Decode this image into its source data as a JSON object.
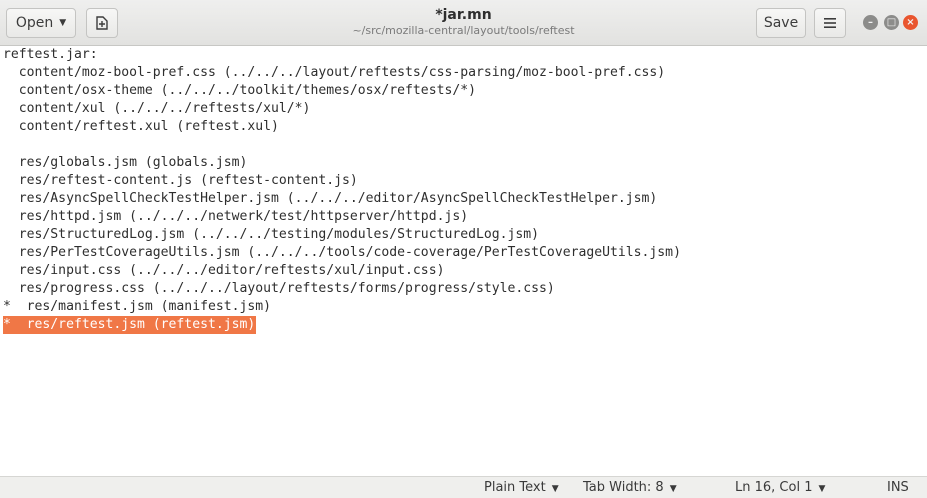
{
  "header": {
    "open_label": "Open",
    "title": "*jar.mn",
    "subtitle": "~/src/mozilla-central/layout/tools/reftest",
    "save_label": "Save"
  },
  "editor": {
    "lines": [
      "reftest.jar:",
      "  content/moz-bool-pref.css (../../../layout/reftests/css-parsing/moz-bool-pref.css)",
      "  content/osx-theme (../../../toolkit/themes/osx/reftests/*)",
      "  content/xul (../../../reftests/xul/*)",
      "  content/reftest.xul (reftest.xul)",
      "",
      "  res/globals.jsm (globals.jsm)",
      "  res/reftest-content.js (reftest-content.js)",
      "  res/AsyncSpellCheckTestHelper.jsm (../../../editor/AsyncSpellCheckTestHelper.jsm)",
      "  res/httpd.jsm (../../../netwerk/test/httpserver/httpd.js)",
      "  res/StructuredLog.jsm (../../../testing/modules/StructuredLog.jsm)",
      "  res/PerTestCoverageUtils.jsm (../../../tools/code-coverage/PerTestCoverageUtils.jsm)",
      "  res/input.css (../../../editor/reftests/xul/input.css)",
      "  res/progress.css (../../../layout/reftests/forms/progress/style.css)",
      "*  res/manifest.jsm (manifest.jsm)",
      "*  res/reftest.jsm (reftest.jsm)"
    ],
    "selection_color": "#f07746"
  },
  "status": {
    "language": "Plain Text",
    "tab_width": "Tab Width: 8",
    "position": "Ln 16, Col 1",
    "mode": "INS"
  }
}
